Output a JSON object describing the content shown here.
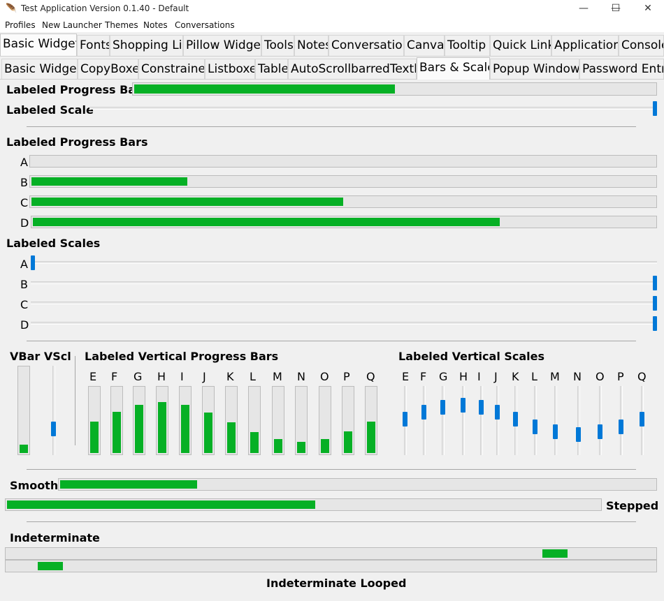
{
  "window": {
    "title": "Test Application Version 0.1.40 - Default",
    "app_icon": "feather-icon",
    "minimize": "—",
    "maximize": "☐",
    "close": "✕"
  },
  "menu": [
    "Profiles",
    "New Launcher",
    "Themes",
    "Notes",
    "Conversations"
  ],
  "tabs_top": [
    "Basic Widget",
    "Fonts",
    "Shopping List",
    "Pillow Widget",
    "Tools",
    "Notes",
    "Conversation",
    "Canvas",
    "Tooltip",
    "Quick Link",
    "Application",
    "Console"
  ],
  "tabs_sub": [
    "Basic Widget",
    "CopyBoxes",
    "Constrained",
    "Listboxes",
    "Table",
    "AutoScrollbarredTextbox",
    "Bars & Scales",
    "Popup Window",
    "Password Entry"
  ],
  "selected_top_tab": "Basic Widget",
  "selected_sub_tab": "Bars & Scales",
  "labeled_progress_bar": {
    "label": "Labeled Progress Bar",
    "value": 0.5
  },
  "labeled_scale": {
    "label": "Labeled Scale",
    "value": 1.0
  },
  "progress_bars": {
    "title": "Labeled Progress Bars",
    "items": [
      {
        "label": "A",
        "value": 0.0
      },
      {
        "label": "B",
        "value": 0.25
      },
      {
        "label": "C",
        "value": 0.5
      },
      {
        "label": "D",
        "value": 0.75
      }
    ]
  },
  "scales": {
    "title": "Labeled Scales",
    "items": [
      {
        "label": "A",
        "value": 0.0
      },
      {
        "label": "B",
        "value": 1.0
      },
      {
        "label": "C",
        "value": 1.0
      },
      {
        "label": "D",
        "value": 1.0
      }
    ]
  },
  "vbar_vscl": {
    "label": "VBar VScl",
    "vbar_value": 0.1,
    "vscale_value": 0.25
  },
  "vertical_progress_bars": {
    "title": "Labeled Vertical Progress Bars",
    "items": [
      {
        "label": "E",
        "value": 0.48
      },
      {
        "label": "F",
        "value": 0.63
      },
      {
        "label": "G",
        "value": 0.74
      },
      {
        "label": "H",
        "value": 0.78
      },
      {
        "label": "I",
        "value": 0.74
      },
      {
        "label": "J",
        "value": 0.62
      },
      {
        "label": "K",
        "value": 0.47
      },
      {
        "label": "L",
        "value": 0.32
      },
      {
        "label": "M",
        "value": 0.21
      },
      {
        "label": "N",
        "value": 0.17
      },
      {
        "label": "O",
        "value": 0.21
      },
      {
        "label": "P",
        "value": 0.33
      },
      {
        "label": "Q",
        "value": 0.48
      }
    ]
  },
  "vertical_scales": {
    "title": "Labeled Vertical Scales",
    "items": [
      {
        "label": "E",
        "value": 0.52
      },
      {
        "label": "F",
        "value": 0.65
      },
      {
        "label": "G",
        "value": 0.75
      },
      {
        "label": "H",
        "value": 0.78
      },
      {
        "label": "I",
        "value": 0.75
      },
      {
        "label": "J",
        "value": 0.65
      },
      {
        "label": "K",
        "value": 0.52
      },
      {
        "label": "L",
        "value": 0.38
      },
      {
        "label": "M",
        "value": 0.29
      },
      {
        "label": "N",
        "value": 0.25
      },
      {
        "label": "O",
        "value": 0.29
      },
      {
        "label": "P",
        "value": 0.38
      },
      {
        "label": "Q",
        "value": 0.52
      }
    ]
  },
  "smooth": {
    "label": "Smooth",
    "value": 0.23
  },
  "stepped": {
    "label": "Stepped",
    "value": 0.52
  },
  "indeterminate": {
    "label": "Indeterminate"
  },
  "indeterminate_looped": {
    "label": "Indeterminate Looped"
  },
  "colors": {
    "fill": "#06b025",
    "thumb": "#0078d7",
    "trough": "#e6e6e6"
  }
}
